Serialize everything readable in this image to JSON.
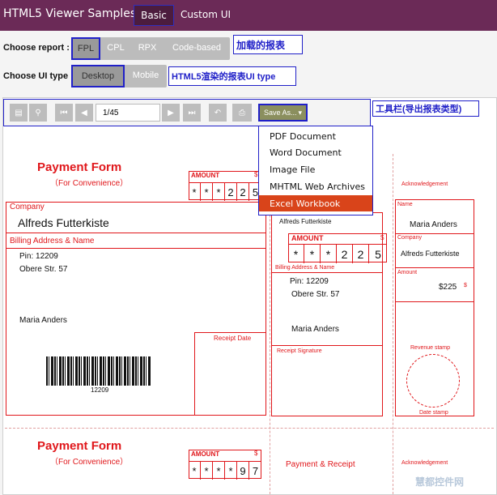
{
  "header": {
    "title": "HTML5 Viewer Samples",
    "tabs": [
      {
        "label": "Basic"
      },
      {
        "label": "Custom UI"
      }
    ]
  },
  "report_chooser": {
    "label": "Choose report :",
    "options": [
      "FPL",
      "CPL",
      "RPX",
      "Code-based"
    ],
    "selected": "FPL",
    "annotation": "加载的报表"
  },
  "ui_chooser": {
    "label": "Choose UI type :",
    "options": [
      "Desktop",
      "Mobile"
    ],
    "selected": "Desktop",
    "annotation": "HTML5渲染的报表UI type"
  },
  "toolbar": {
    "page_value": "1/45",
    "save_label": "Save As...",
    "annotation": "工具栏(导出报表类型)",
    "save_menu": [
      "PDF Document",
      "Word Document",
      "Image File",
      "MHTML Web Archives",
      "Excel Workbook"
    ],
    "save_menu_selected": "Excel Workbook"
  },
  "report": {
    "form_title": "Payment Form",
    "form_subtitle": "（For Convenience）",
    "amount_label": "AMOUNT",
    "dollar": "$",
    "amount_digits_1": [
      "*",
      "*",
      "*",
      "2",
      "2",
      "5"
    ],
    "amount_digits_2": [
      "*",
      "*",
      "*",
      "*",
      "9",
      "7"
    ],
    "company_label": "Company",
    "company_value": "Alfreds Futterkiste",
    "billing_label": "Billing Address & Name",
    "pin": "Pin: 12209",
    "street": "Obere Str. 57",
    "person": "Maria Anders",
    "barcode_text": "12209",
    "receipt_date_label": "Receipt Date",
    "receipt_signature_label": "Receipt Signature",
    "acknowledgement": "Acknowledgement",
    "name_label": "Name",
    "amount_small_label": "Amount",
    "amount_value": "$225",
    "revenue_stamp": "Revenue stamp",
    "date_stamp": "Date stamp",
    "payment_receipt": "Payment & Receipt",
    "watermark": "慧都控件网"
  },
  "colors": {
    "header": "#6b2a57",
    "accent_red": "#e0171b",
    "annotation_blue": "#2020c8",
    "menu_highlight": "#d9441a"
  }
}
